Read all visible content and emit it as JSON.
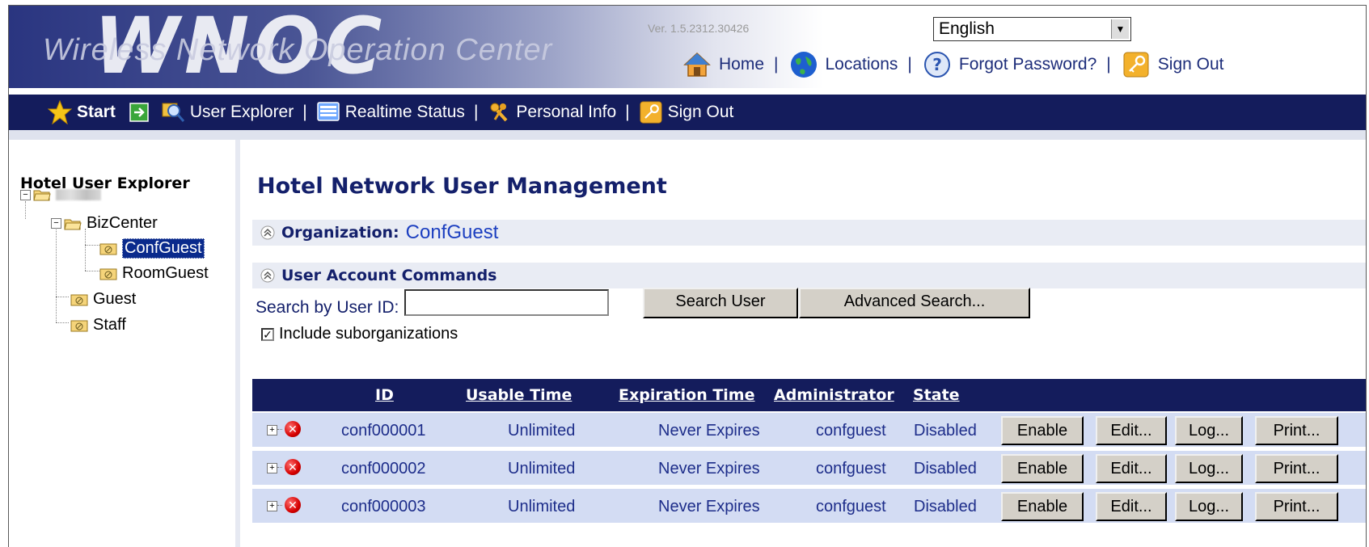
{
  "header": {
    "logo_text": "WNOC",
    "logo_subtitle": "Wireless Network Operation Center",
    "version": "Ver. 1.5.2312.30426",
    "language": "English",
    "links": [
      {
        "label": "Home",
        "icon": "home-icon"
      },
      {
        "label": "Locations",
        "icon": "globe-icon"
      },
      {
        "label": "Forgot Password?",
        "icon": "help-icon"
      },
      {
        "label": "Sign Out",
        "icon": "key-icon"
      }
    ]
  },
  "nav": {
    "items": [
      {
        "label": "Start",
        "icon": "star-icon"
      },
      {
        "label": "User Explorer",
        "icon": "magnifier-icon"
      },
      {
        "label": "Realtime Status",
        "icon": "monitor-icon"
      },
      {
        "label": "Personal Info",
        "icon": "keys-icon"
      },
      {
        "label": "Sign Out",
        "icon": "key-icon"
      }
    ]
  },
  "sidebar": {
    "title": "Hotel User Explorer",
    "tree": [
      {
        "label": "BizCenter"
      },
      {
        "label": "ConfGuest",
        "selected": true
      },
      {
        "label": "RoomGuest"
      },
      {
        "label": "Guest"
      },
      {
        "label": "Staff"
      }
    ]
  },
  "main": {
    "title": "Hotel Network User Management",
    "org_label": "Organization:",
    "org_value": "ConfGuest",
    "commands_label": "User Account Commands",
    "search_label": "Search by User ID:",
    "search_value": "",
    "search_button": "Search User",
    "advanced_button": "Advanced Search...",
    "include_sub_label": "Include suborganizations",
    "include_sub_checked": true
  },
  "table": {
    "headers": [
      "ID",
      "Usable Time",
      "Expiration Time",
      "Administrator",
      "State"
    ],
    "rows": [
      {
        "id": "conf000001",
        "usable": "Unlimited",
        "expiration": "Never Expires",
        "admin": "confguest",
        "state": "Disabled"
      },
      {
        "id": "conf000002",
        "usable": "Unlimited",
        "expiration": "Never Expires",
        "admin": "confguest",
        "state": "Disabled"
      },
      {
        "id": "conf000003",
        "usable": "Unlimited",
        "expiration": "Never Expires",
        "admin": "confguest",
        "state": "Disabled"
      }
    ],
    "actions": [
      "Enable",
      "Edit...",
      "Log...",
      "Print..."
    ]
  },
  "colors": {
    "navbar": "#141c5c",
    "row_bg": "#d3dcf3",
    "title_text": "#14206b",
    "link_text": "#1c3fc0"
  }
}
